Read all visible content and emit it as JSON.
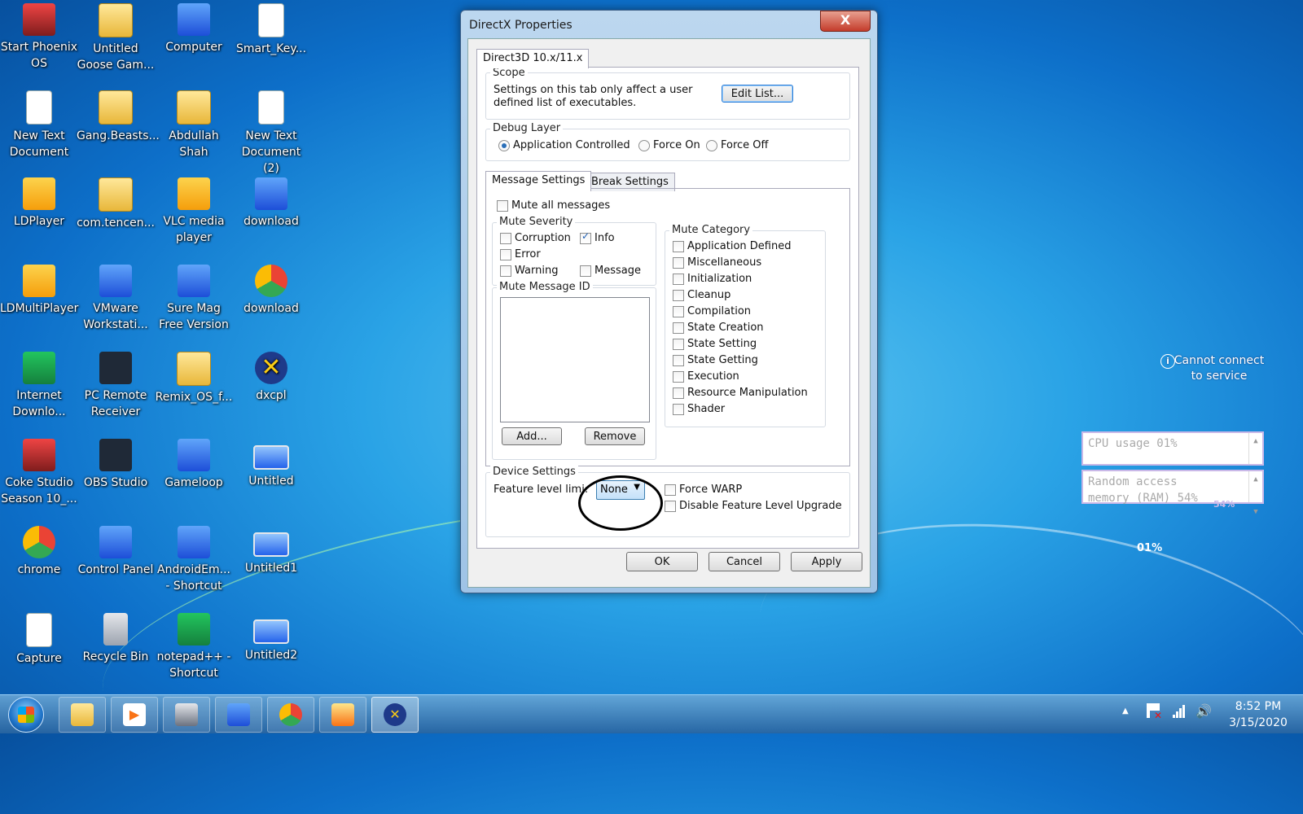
{
  "desktop_icons": [
    {
      "label": "Start Phoenix OS",
      "icon": "phoenix-icon"
    },
    {
      "label": "Untitled Goose Gam...",
      "icon": "folder-icon"
    },
    {
      "label": "Computer",
      "icon": "computer-icon"
    },
    {
      "label": "Smart_Key...",
      "icon": "document-icon"
    },
    {
      "label": "New Text Document",
      "icon": "document-icon"
    },
    {
      "label": "Gang.Beasts...",
      "icon": "folder-icon"
    },
    {
      "label": "Abdullah Shah",
      "icon": "user-folder-icon"
    },
    {
      "label": "New Text Document (2)",
      "icon": "document-icon"
    },
    {
      "label": "LDPlayer",
      "icon": "ldplayer-icon"
    },
    {
      "label": "com.tencen...",
      "icon": "folder-icon"
    },
    {
      "label": "VLC media player",
      "icon": "vlc-icon"
    },
    {
      "label": "download",
      "icon": "web-icon"
    },
    {
      "label": "LDMultiPlayer",
      "icon": "ldmultiplayer-icon"
    },
    {
      "label": "VMware Workstati...",
      "icon": "vmware-icon"
    },
    {
      "label": "Sure Mag Free Version",
      "icon": "app-icon"
    },
    {
      "label": "download",
      "icon": "chrome-file-icon"
    },
    {
      "label": "Internet Downlo...",
      "icon": "idm-icon"
    },
    {
      "label": "PC Remote Receiver",
      "icon": "remote-icon"
    },
    {
      "label": "Remix_OS_f...",
      "icon": "folder-icon"
    },
    {
      "label": "dxcpl",
      "icon": "dxcpl-icon"
    },
    {
      "label": "Coke Studio Season 10_...",
      "icon": "video-icon"
    },
    {
      "label": "OBS Studio",
      "icon": "obs-icon"
    },
    {
      "label": "Gameloop",
      "icon": "gameloop-icon"
    },
    {
      "label": "Untitled",
      "icon": "image-icon"
    },
    {
      "label": "chrome",
      "icon": "chrome-icon"
    },
    {
      "label": "Control Panel",
      "icon": "control-panel-icon"
    },
    {
      "label": "AndroidEm... - Shortcut",
      "icon": "gameloop-icon"
    },
    {
      "label": "Untitled1",
      "icon": "image-icon"
    },
    {
      "label": "Capture",
      "icon": "document-icon"
    },
    {
      "label": "Recycle Bin",
      "icon": "recycle-bin-icon"
    },
    {
      "label": "notepad++ - Shortcut",
      "icon": "notepadpp-icon"
    },
    {
      "label": "Untitled2",
      "icon": "image-icon"
    }
  ],
  "dialog": {
    "title": "DirectX Properties",
    "close_label": "X",
    "main_tab": "Direct3D 10.x/11.x",
    "scope": {
      "legend": "Scope",
      "text_line1": "Settings on this tab only affect a user",
      "text_line2": "defined list of executables.",
      "edit_list": "Edit List..."
    },
    "debug_layer": {
      "legend": "Debug Layer",
      "options": [
        "Application Controlled",
        "Force On",
        "Force Off"
      ],
      "selected": "Application Controlled"
    },
    "subtabs": [
      "Message Settings",
      "Break Settings"
    ],
    "mute_all": "Mute all messages",
    "mute_severity": {
      "legend": "Mute Severity",
      "items": [
        "Corruption",
        "Info",
        "Error",
        "Warning",
        "Message"
      ],
      "checked": [
        "Info"
      ]
    },
    "mute_message_id": {
      "legend": "Mute Message ID",
      "add": "Add...",
      "remove": "Remove"
    },
    "mute_category": {
      "legend": "Mute Category",
      "items": [
        "Application Defined",
        "Miscellaneous",
        "Initialization",
        "Cleanup",
        "Compilation",
        "State Creation",
        "State Setting",
        "State Getting",
        "Execution",
        "Resource Manipulation",
        "Shader"
      ]
    },
    "device_settings": {
      "legend": "Device Settings",
      "feature_label": "Feature level limi",
      "feature_label_colon": ":",
      "feature_value": "None",
      "force_warp": "Force WARP",
      "disable_upgrade": "Disable Feature Level Upgrade"
    },
    "buttons": {
      "ok": "OK",
      "cancel": "Cancel",
      "apply": "Apply"
    }
  },
  "widgets": {
    "notice_line1": "Cannot connect",
    "notice_line2": "to service",
    "cpu": "CPU usage 01%",
    "ram_line1": "Random access",
    "ram_line2": "memory (RAM) 54%",
    "ram_pct_overlay": "54%",
    "cpu_pct": "01%"
  },
  "taskbar": {
    "clock_time": "8:52 PM",
    "clock_date": "3/15/2020",
    "show_hidden": "▲",
    "pinned": [
      {
        "icon": "file-explorer-icon"
      },
      {
        "icon": "media-player-icon"
      },
      {
        "icon": "pc-remote-icon"
      },
      {
        "icon": "gameloop-icon"
      },
      {
        "icon": "chrome-icon"
      },
      {
        "icon": "paint-icon"
      },
      {
        "icon": "dxcpl-icon"
      }
    ]
  },
  "colors": {
    "desktop_bg": "#1a8ad8",
    "dialog_frame": "#a9cbeb",
    "close_button": "#c43c2b",
    "accent": "#2a7bd3"
  }
}
